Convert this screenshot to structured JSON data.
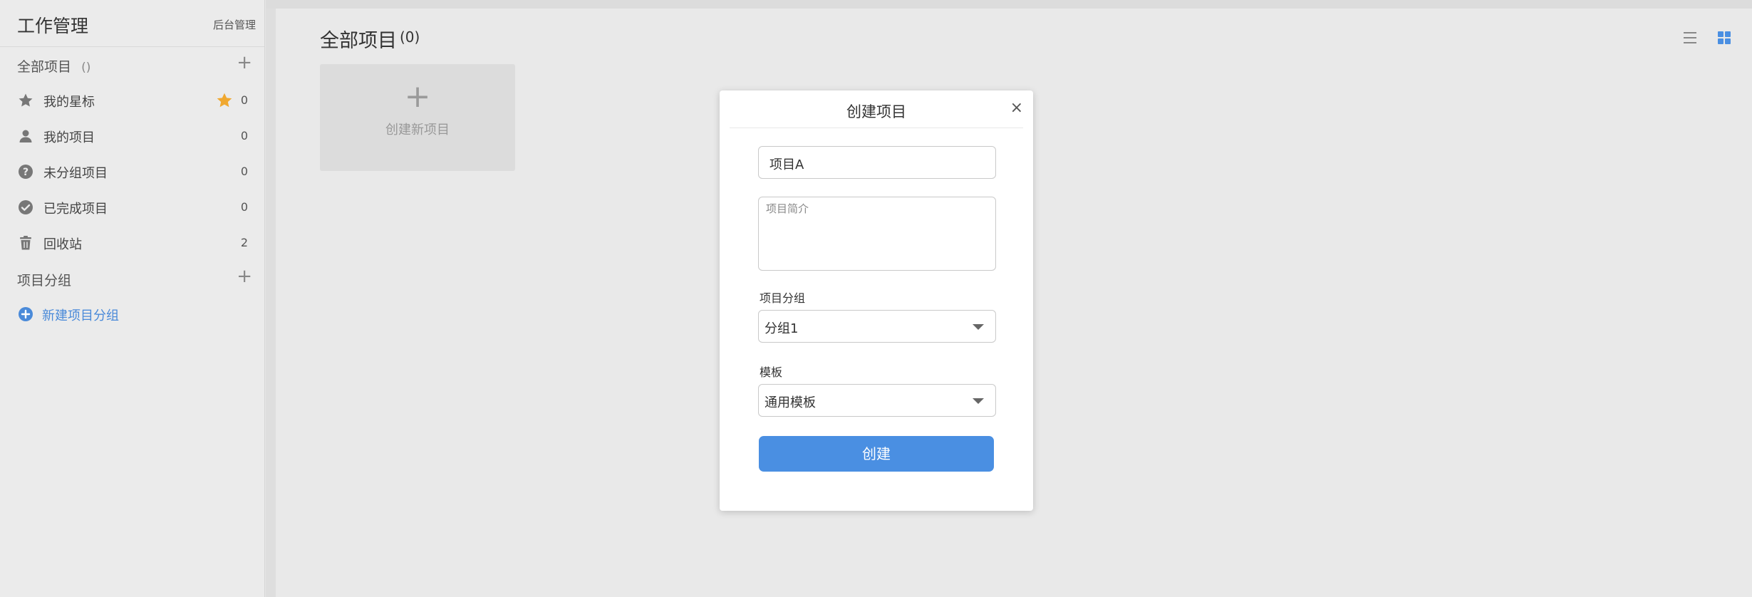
{
  "sidebar": {
    "title": "工作管理",
    "admin_link": "后台管理",
    "all_projects": {
      "label": "全部项目",
      "count": "()"
    },
    "items": [
      {
        "label": "我的星标",
        "count": "0",
        "icon": "star-icon"
      },
      {
        "label": "我的项目",
        "count": "0",
        "icon": "user-icon"
      },
      {
        "label": "未分组项目",
        "count": "0",
        "icon": "question-icon"
      },
      {
        "label": "已完成项目",
        "count": "0",
        "icon": "check-circle-icon"
      },
      {
        "label": "回收站",
        "count": "2",
        "icon": "trash-icon"
      }
    ],
    "groups_header": "项目分组",
    "new_group": "新建项目分组"
  },
  "main": {
    "title": "全部项目",
    "count": "(0)",
    "new_project_card": {
      "plus": "+",
      "label": "创建新项目"
    }
  },
  "modal": {
    "title": "创建项目",
    "close": "×",
    "name_value": "项目A",
    "desc_placeholder": "项目简介",
    "group_label": "项目分组",
    "group_value": "分组1",
    "template_label": "模板",
    "template_value": "通用模板",
    "submit_label": "创建"
  },
  "colors": {
    "accent": "#4a8fe2",
    "star": "#f0a830",
    "link": "#4a8ad9"
  }
}
